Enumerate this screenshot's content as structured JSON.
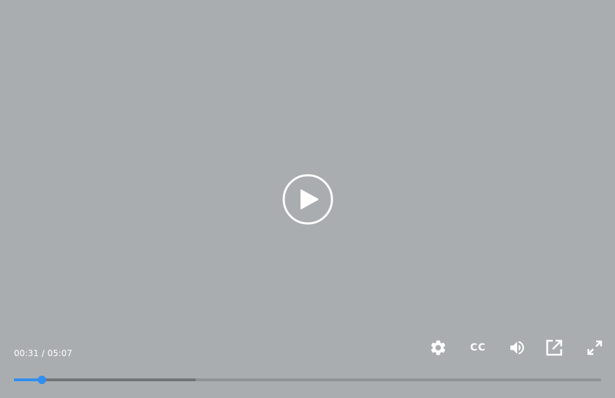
{
  "player": {
    "time": {
      "current": "00:31",
      "separator": "/",
      "duration": "05:07"
    },
    "progress": {
      "played_fraction": 0.048,
      "buffered_fraction": 0.31
    },
    "controls": {
      "big_play_icon": "play-circle-icon",
      "settings_icon": "gear-icon",
      "captions_label": "CC",
      "volume_icon": "speaker-icon",
      "popout_icon": "external-link-icon",
      "fullscreen_icon": "expand-icon"
    },
    "colors": {
      "accent": "#2f8ef0",
      "icon": "#ffffff",
      "background": "#aaadb0"
    }
  }
}
